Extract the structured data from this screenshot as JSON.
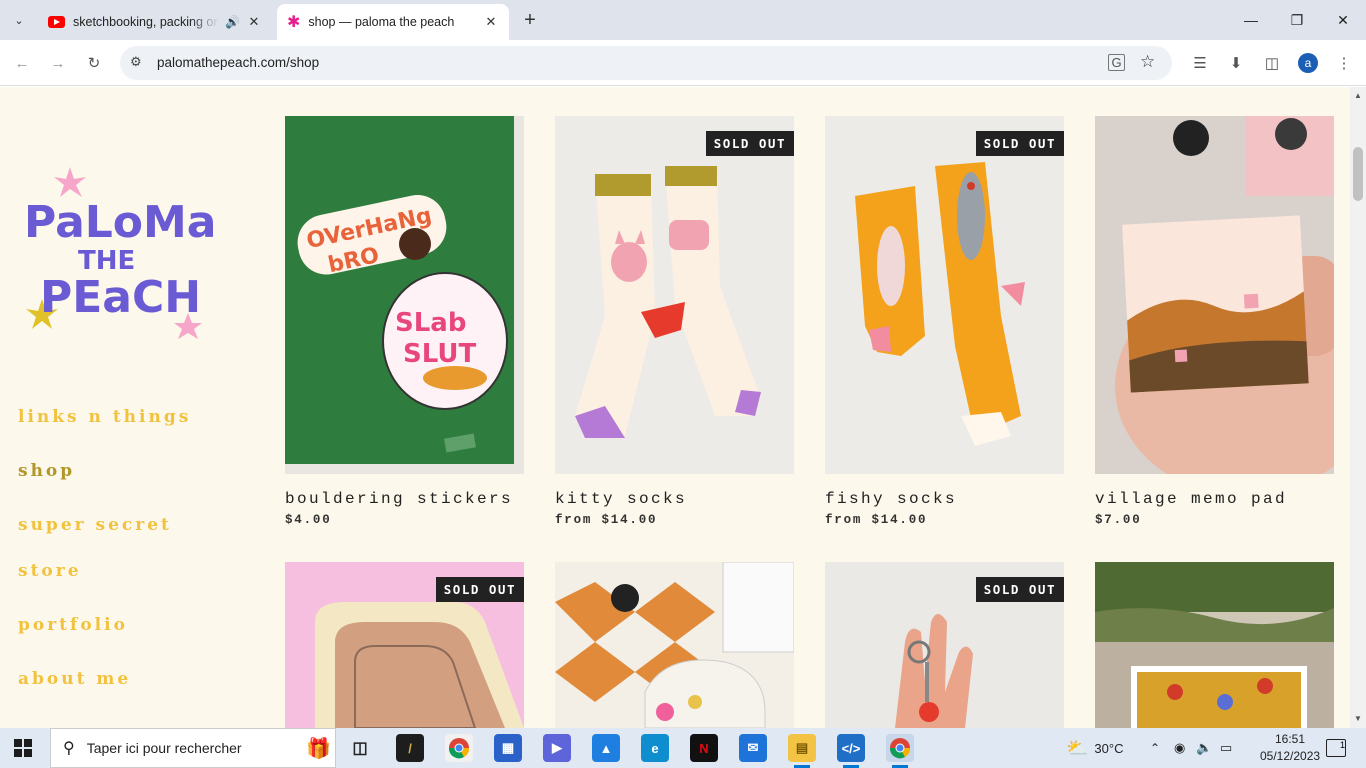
{
  "browser": {
    "tabs": [
      {
        "title": "sketchbooking, packing ord",
        "favicon": "youtube-icon",
        "audio": true,
        "active": false
      },
      {
        "title": "shop — paloma the peach",
        "favicon": "star-icon",
        "active": true
      }
    ],
    "url": "palomathepeach.com/shop",
    "profile_initial": "a"
  },
  "site": {
    "logo_text": [
      "PaLoMa",
      "THE",
      "PEaCH"
    ],
    "nav": [
      {
        "label": "links n things",
        "active": false
      },
      {
        "label": "shop",
        "active": true
      },
      {
        "label": "super secret",
        "active": false
      },
      {
        "label": "store",
        "active": false
      },
      {
        "label": "portfolio",
        "active": false
      },
      {
        "label": "about me",
        "active": false
      }
    ],
    "products": [
      {
        "name": "bouldering stickers",
        "price": "$4.00",
        "sold_out": false
      },
      {
        "name": "kitty socks",
        "price": "from $14.00",
        "sold_out": true
      },
      {
        "name": "fishy socks",
        "price": "from $14.00",
        "sold_out": true
      },
      {
        "name": "village memo pad",
        "price": "$7.00",
        "sold_out": false
      },
      {
        "name": "",
        "price": "",
        "sold_out": true
      },
      {
        "name": "",
        "price": "",
        "sold_out": false
      },
      {
        "name": "",
        "price": "",
        "sold_out": true
      },
      {
        "name": "",
        "price": "",
        "sold_out": false
      }
    ],
    "sold_out_label": "SOLD OUT",
    "sticker_text": [
      "OVerHaNg",
      "bRO",
      "SLab",
      "SLUT"
    ],
    "accent_color": "#f2c23e",
    "logo_color": "#6a5ad3"
  },
  "taskbar": {
    "search_placeholder": "Taper ici pour rechercher",
    "weather": "30°C",
    "time": "16:51",
    "date": "05/12/2023",
    "notification_count": "1"
  }
}
